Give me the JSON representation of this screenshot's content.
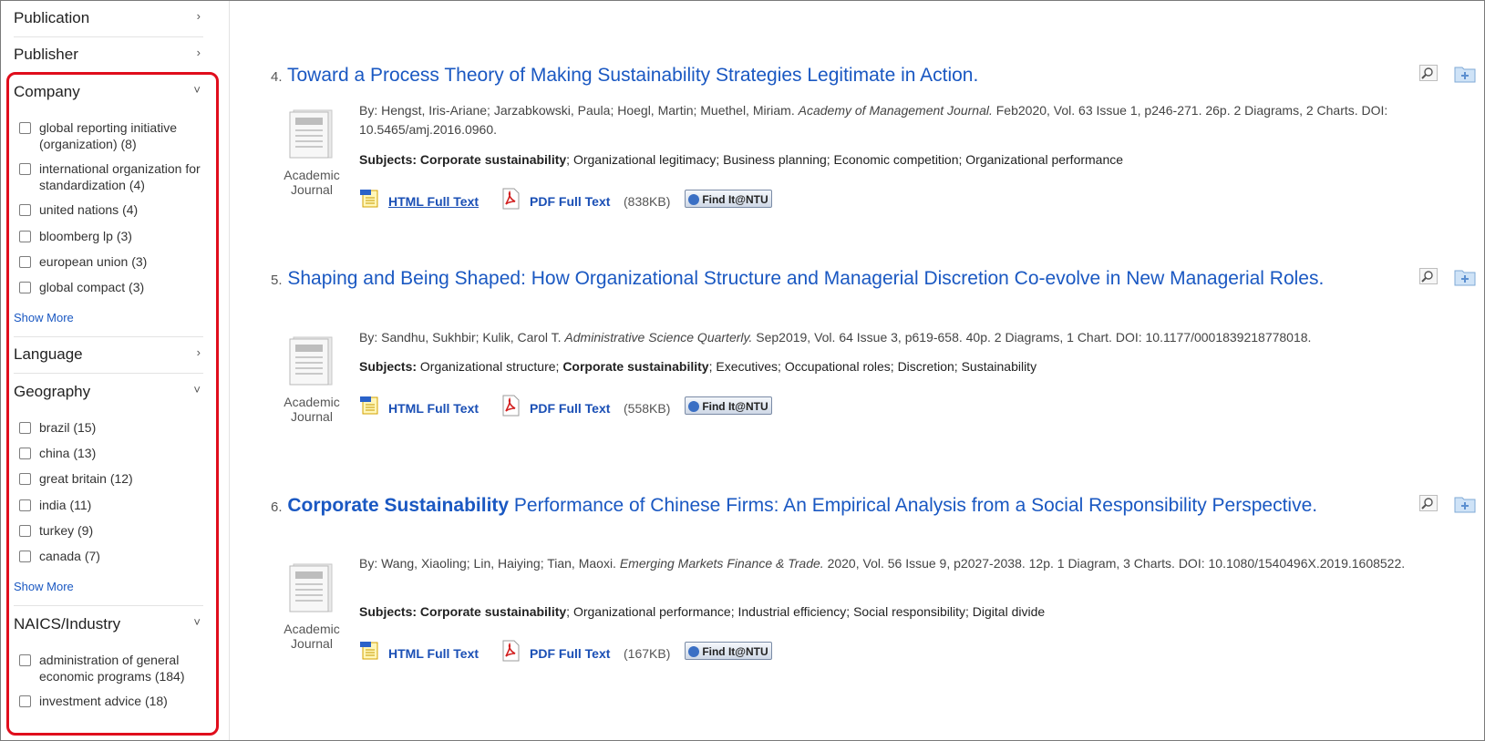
{
  "sidebar": {
    "publication": "Publication",
    "publisher": "Publisher",
    "company": {
      "title": "Company",
      "options": [
        {
          "label": "global reporting initiative (organization) (8)"
        },
        {
          "label": "international organization for standardization (4)"
        },
        {
          "label": "united nations (4)"
        },
        {
          "label": "bloomberg lp (3)"
        },
        {
          "label": "european union (3)"
        },
        {
          "label": "global compact (3)"
        }
      ],
      "show_more": "Show More"
    },
    "language": "Language",
    "geography": {
      "title": "Geography",
      "options": [
        {
          "label": "brazil (15)"
        },
        {
          "label": "china (13)"
        },
        {
          "label": "great britain (12)"
        },
        {
          "label": "india (11)"
        },
        {
          "label": "turkey (9)"
        },
        {
          "label": "canada (7)"
        }
      ],
      "show_more": "Show More"
    },
    "naics": {
      "title": "NAICS/Industry",
      "options": [
        {
          "label": "administration of general economic programs (184)"
        },
        {
          "label": "investment advice (18)"
        }
      ]
    },
    "icons": {
      "chevron_right": "›",
      "chevron_down": "˅"
    }
  },
  "results": [
    {
      "num": "4.",
      "title_bold": "",
      "title": "Toward a Process Theory of Making Sustainability Strategies Legitimate in Action.",
      "by_pre": "By: Hengst, Iris-Ariane; Jarzabkowski, Paula; Hoegl, Martin; Muethel, Miriam. ",
      "journal": "Academy of Management Journal.",
      "by_post": " Feb2020, Vol. 63 Issue 1, p246-271. 26p. 2 Diagrams, 2 Charts. DOI: 10.5465/amj.2016.0960.",
      "subjects_label": "Subjects:",
      "subjects_bold": "Corporate sustainability",
      "subjects_rest": "; Organizational legitimacy; Business planning; Economic competition; Organizational performance",
      "subjects_pre": "",
      "pub_type_1": "Academic",
      "pub_type_2": "Journal",
      "html_link": "HTML Full Text",
      "pdf_link": "PDF Full Text",
      "pdf_size": "(838KB)",
      "findit": "Find It@NTU"
    },
    {
      "num": "5.",
      "title_bold": "",
      "title": "Shaping and Being Shaped: How Organizational Structure and Managerial Discretion Co-evolve in New Managerial Roles.",
      "by_pre": "By: Sandhu, Sukhbir; Kulik, Carol T. ",
      "journal": "Administrative Science Quarterly.",
      "by_post": " Sep2019, Vol. 64 Issue 3, p619-658. 40p. 2 Diagrams, 1 Chart. DOI: 10.1177/0001839218778018.",
      "subjects_label": "Subjects:",
      "subjects_pre": " Organizational structure; ",
      "subjects_bold": "Corporate sustainability",
      "subjects_rest": "; Executives; Occupational roles; Discretion; Sustainability",
      "pub_type_1": "Academic",
      "pub_type_2": "Journal",
      "html_link": "HTML Full Text",
      "pdf_link": "PDF Full Text",
      "pdf_size": "(558KB)",
      "findit": "Find It@NTU"
    },
    {
      "num": "6.",
      "title_bold": "Corporate Sustainability",
      "title": " Performance of Chinese Firms: An Empirical Analysis from a Social Responsibility Perspective.",
      "by_pre": "By: Wang, Xiaoling; Lin, Haiying; Tian, Maoxi. ",
      "journal": "Emerging Markets Finance & Trade.",
      "by_post": " 2020, Vol. 56 Issue 9, p2027-2038. 12p. 1 Diagram, 3 Charts. DOI: 10.1080/1540496X.2019.1608522.",
      "subjects_label": "Subjects:",
      "subjects_pre": "",
      "subjects_bold": "Corporate sustainability",
      "subjects_rest": "; Organizational performance; Industrial efficiency; Social responsibility; Digital divide",
      "pub_type_1": "Academic",
      "pub_type_2": "Journal",
      "html_link": "HTML Full Text",
      "pdf_link": "PDF Full Text",
      "pdf_size": "(167KB)",
      "findit": "Find It@NTU"
    }
  ]
}
